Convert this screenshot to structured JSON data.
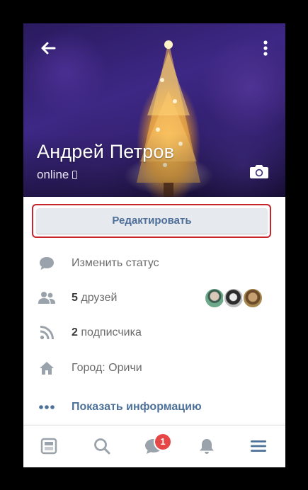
{
  "profile": {
    "name": "Андрей Петров",
    "status": "online"
  },
  "actions": {
    "edit_label": "Редактировать"
  },
  "info": {
    "change_status": "Изменить статус",
    "friends_count": "5",
    "friends_label": " друзей",
    "followers_count": "2",
    "followers_label": " подписчика",
    "city": "Город: Оричи",
    "show_info": "Показать информацию"
  },
  "nav": {
    "messages_badge": "1"
  },
  "colors": {
    "accent": "#4d7199",
    "highlight_frame": "#c8242b",
    "badge": "#e64646",
    "icon_gray": "#9aa2ab"
  },
  "icons": [
    "back-arrow-icon",
    "more-vertical-icon",
    "camera-icon",
    "phone-icon",
    "comment-icon",
    "friends-icon",
    "rss-icon",
    "home-icon",
    "more-horizontal-icon",
    "news-icon",
    "search-icon",
    "messages-icon",
    "bell-icon",
    "menu-icon"
  ]
}
